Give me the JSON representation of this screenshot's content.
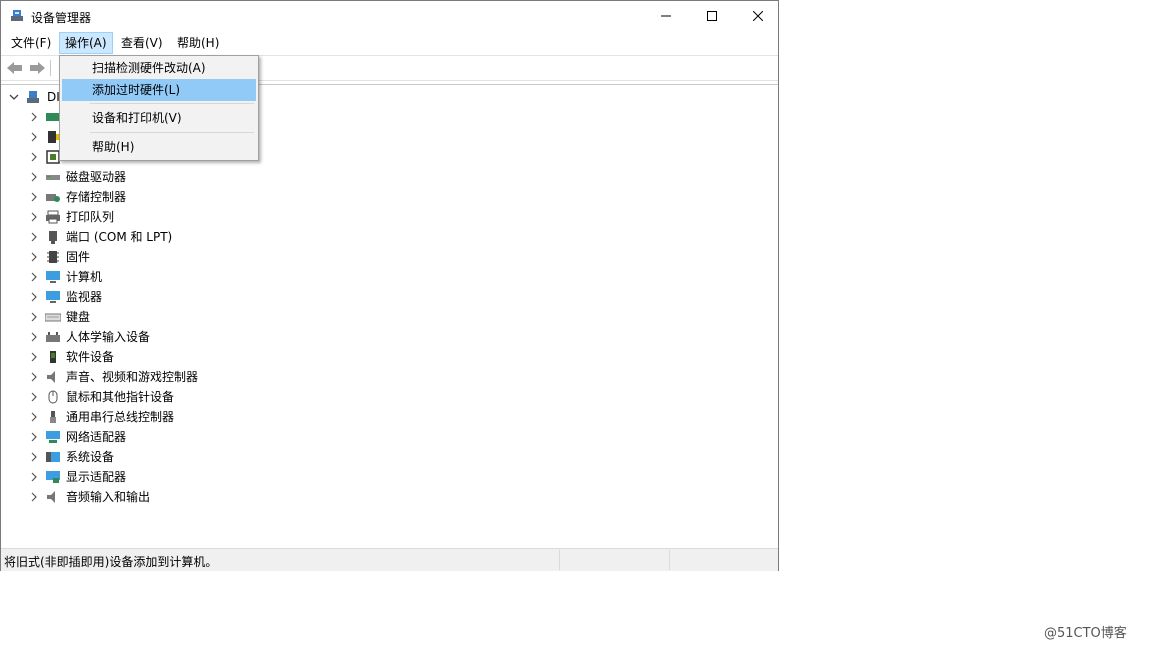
{
  "window": {
    "title": "设备管理器",
    "minimize_glyph": "—",
    "maximize_glyph": "☐",
    "close_glyph": "✕"
  },
  "menubar": {
    "items": [
      {
        "label": "文件(F)"
      },
      {
        "label": "操作(A)"
      },
      {
        "label": "查看(V)"
      },
      {
        "label": "帮助(H)"
      }
    ]
  },
  "dropdown": {
    "items": [
      {
        "label": "扫描检测硬件改动(A)"
      },
      {
        "label": "添加过时硬件(L)"
      },
      {
        "label": "设备和打印机(V)"
      },
      {
        "label": "帮助(H)"
      }
    ]
  },
  "tree": {
    "root_label": "DI",
    "nodes": [
      {
        "label": "磁盘驱动器",
        "icon": "disk-drive-icon"
      },
      {
        "label": "存储控制器",
        "icon": "storage-controller-icon"
      },
      {
        "label": "打印队列",
        "icon": "printer-icon"
      },
      {
        "label": "端口 (COM 和 LPT)",
        "icon": "port-icon"
      },
      {
        "label": "固件",
        "icon": "firmware-icon"
      },
      {
        "label": "计算机",
        "icon": "computer-icon"
      },
      {
        "label": "监视器",
        "icon": "monitor-icon"
      },
      {
        "label": "键盘",
        "icon": "keyboard-icon"
      },
      {
        "label": "人体学输入设备",
        "icon": "hid-icon"
      },
      {
        "label": "软件设备",
        "icon": "software-device-icon"
      },
      {
        "label": "声音、视频和游戏控制器",
        "icon": "speaker-icon"
      },
      {
        "label": "鼠标和其他指针设备",
        "icon": "mouse-icon"
      },
      {
        "label": "通用串行总线控制器",
        "icon": "usb-icon"
      },
      {
        "label": "网络适配器",
        "icon": "network-adapter-icon"
      },
      {
        "label": "系统设备",
        "icon": "system-device-icon"
      },
      {
        "label": "显示适配器",
        "icon": "display-adapter-icon"
      },
      {
        "label": "音频输入和输出",
        "icon": "audio-io-icon"
      }
    ]
  },
  "status": {
    "text": "将旧式(非即插即用)设备添加到计算机。"
  },
  "watermark": "@51CTO博客"
}
